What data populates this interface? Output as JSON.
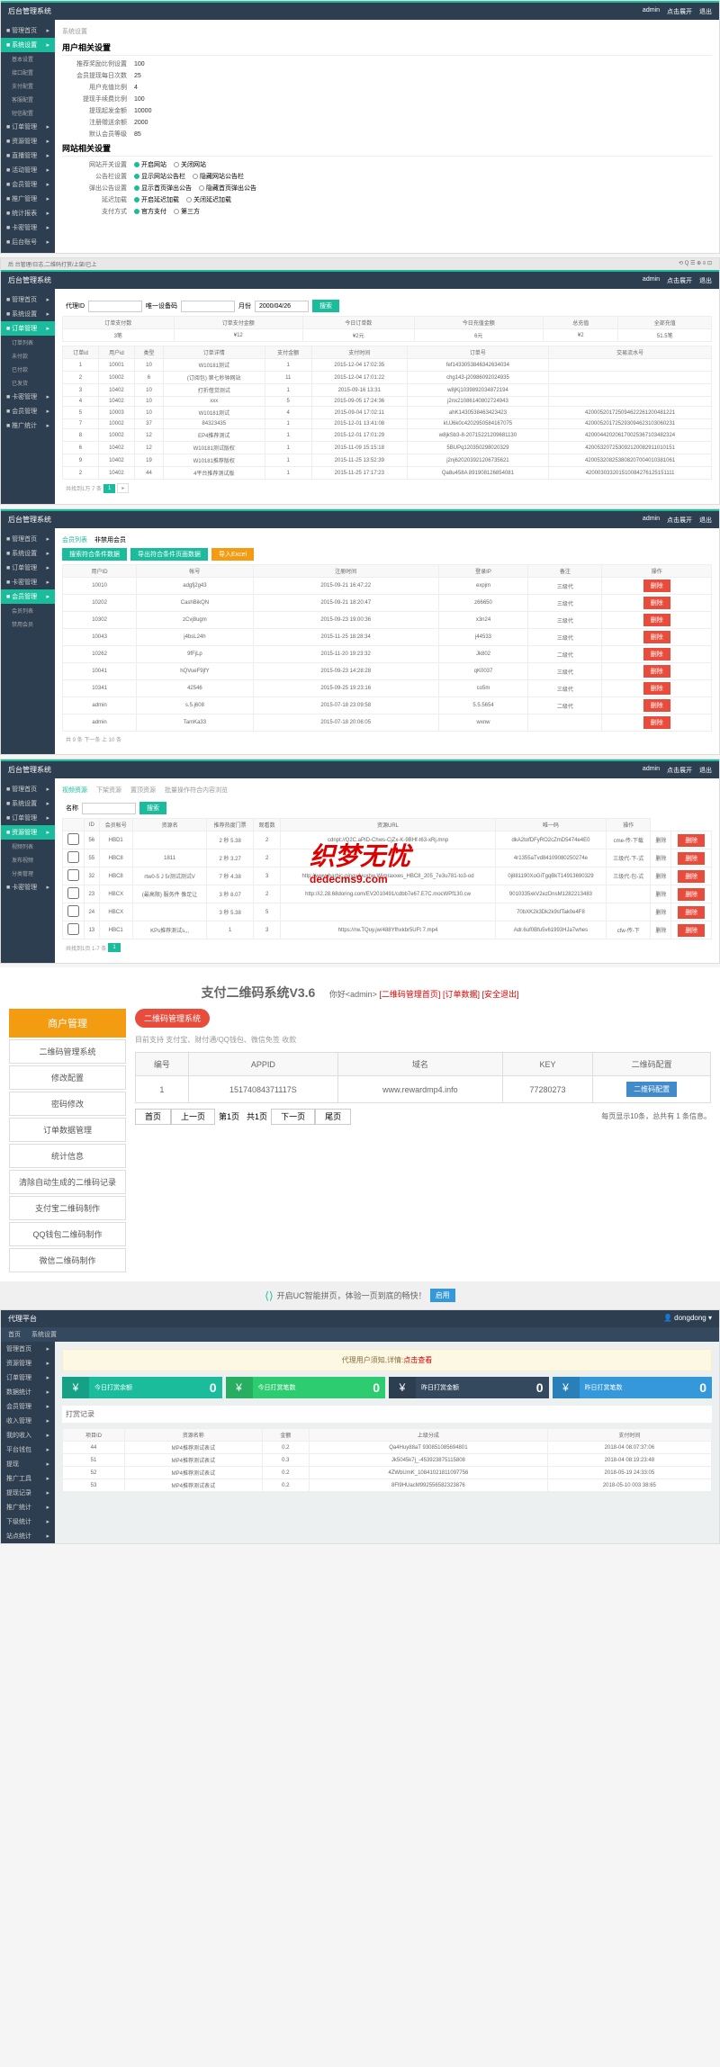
{
  "p1": {
    "title": "后台管理系统",
    "user": "admin",
    "menu_toggle": "点击展开",
    "logout": "退出",
    "sidebar": [
      "管理首页",
      "系统设置",
      "订单管理",
      "资源管理",
      "直播管理",
      "活动管理",
      "会员管理",
      "推广管理",
      "统计报表",
      "卡密管理",
      "后台账号"
    ],
    "sub_items": [
      "基本设置",
      "接口配置",
      "支付配置",
      "客服配置",
      "短信配置"
    ],
    "tab": "系统设置",
    "sec1": "用户相关设置",
    "rows1": [
      {
        "l": "推荐奖励比例设置",
        "v": "100"
      },
      {
        "l": "会员提现每日次数",
        "v": "25"
      },
      {
        "l": "用户充值比例",
        "v": "4"
      },
      {
        "l": "提现手续费比例",
        "v": "100"
      },
      {
        "l": "提现起发金额",
        "v": "10000"
      },
      {
        "l": "注册赠送余额",
        "v": "2000"
      },
      {
        "l": "默认会员等级",
        "v": "85"
      }
    ],
    "sec2": "网站相关设置",
    "rows2": [
      {
        "l": "网站开关设置",
        "opts": [
          "开启网站",
          "关闭网站"
        ]
      },
      {
        "l": "公告栏设置",
        "opts": [
          "显示网站公告栏",
          "隐藏网站公告栏"
        ]
      },
      {
        "l": "弹出公告设置",
        "opts": [
          "显示首页弹出公告",
          "隐藏首页弹出公告"
        ]
      },
      {
        "l": "延迟加载",
        "opts": [
          "开启延迟加载",
          "关闭延迟加载"
        ]
      },
      {
        "l": "支付方式",
        "opts": [
          "官方支付",
          "第三方"
        ]
      }
    ]
  },
  "p2": {
    "title": "后台管理系统",
    "user": "admin",
    "sidebar": [
      "管理首页",
      "系统设置",
      "订单管理",
      "卡密管理",
      "会员管理",
      "推广统计"
    ],
    "sub_items": [
      "订单列表",
      "未付款",
      "已付款",
      "已发货"
    ],
    "toolbar": {
      "l1": "代理ID",
      "l2": "唯一设备码",
      "l3": "月份",
      "date": "2000/04/26",
      "btn": "搜索"
    },
    "summary_headers": [
      "订单支付数",
      "订单支付金额",
      "今日订单数",
      "今日充值金额",
      "总充值",
      "全部充值"
    ],
    "summary_values": [
      "3笔",
      "¥12",
      "¥2元",
      "6元",
      "¥2",
      "51.5笔"
    ],
    "cols": [
      "订单id",
      "用户id",
      "类型",
      "订单详情",
      "支付金额",
      "支付时间",
      "订单号",
      "交易流水号"
    ],
    "rows": [
      [
        "1",
        "10001",
        "10",
        "W10181测试",
        "1",
        "2015-12-04 17:02:35",
        "fef1433053846342634034",
        ""
      ],
      [
        "2",
        "10002",
        "6",
        "(订阅包) 第七秒钟网站",
        "11",
        "2015-12-04 17:01:22",
        "chg143-j20986092024935",
        ""
      ],
      [
        "3",
        "10402",
        "10",
        "打折借贷测试",
        "1",
        "2015-09-16 13:31",
        "w8jKj1039892034872194",
        ""
      ],
      [
        "4",
        "10402",
        "10",
        "xxx",
        "5",
        "2015-09-05 17:24:36",
        "j2nx21086140802724943",
        ""
      ],
      [
        "5",
        "10003",
        "10",
        "W10181测试",
        "4",
        "2015-09-04 17:02:11",
        "ahK1430538463423423",
        "420005201725094622261200481221"
      ],
      [
        "7",
        "10002",
        "37",
        "84323435",
        "1",
        "2015-12-01 13:41:08",
        "kUJ6k0c4202950584167075",
        "420005201725293094623103060231"
      ],
      [
        "8",
        "10002",
        "12",
        "EP4推荐测试",
        "1",
        "2015-12-01 17:01:29",
        "w8jkSb3-8-20715221209681130",
        "420004420206170025367103482324"
      ],
      [
        "6",
        "10402",
        "12",
        "W10181测试版权",
        "1",
        "2015-11-09 15:15:18",
        "5BUPq120350298020329",
        "420053207253092120082911010151"
      ],
      [
        "9",
        "10402",
        "19",
        "W10181推荐版权",
        "1",
        "2015-11-25 13:52:39",
        "j2nj620203921206735621",
        "420053208253808207004010381061"
      ],
      [
        "2",
        "10402",
        "44",
        "4平台推荐测试版",
        "1",
        "2015-11-25 17:17:23",
        "Qa8u458A 891908126854081",
        "420003033201510084276125151111"
      ]
    ],
    "pager_info": "共找到1万 7 条"
  },
  "p3": {
    "title": "后台管理系统",
    "user": "admin",
    "sidebar": [
      "管理首页",
      "系统设置",
      "订单管理",
      "卡密管理",
      "会员管理"
    ],
    "sub_items": [
      "会员列表",
      "禁用会员"
    ],
    "tabs": [
      "会员列表",
      "非禁用会员"
    ],
    "btns": [
      "搜索符合条件数据",
      "导出符合条件页面数据",
      "导入Excel"
    ],
    "cols": [
      "用户ID",
      "帐号",
      "注册时间",
      "登录IP",
      "备注",
      "操作"
    ],
    "rows": [
      [
        "10010",
        "adgfj2g43",
        "2015-09-21 16:47:22",
        "expjm",
        "三级代",
        "删除"
      ],
      [
        "10202",
        "CashBikQN",
        "2015-09-21 18:20:47",
        "z66650",
        "三级代",
        "删除"
      ],
      [
        "10302",
        "zCvj8ugm",
        "2015-09-23 19:00:36",
        "x3n24",
        "三级代",
        "删除"
      ],
      [
        "10043",
        "j4bsL24h",
        "2015-11-25 18:28:34",
        "j44533",
        "三级代",
        "删除"
      ],
      [
        "10262",
        "9fFjLp",
        "2015-11-20 19:23:32",
        "Jk802",
        "二级代",
        "删除"
      ],
      [
        "10041",
        "hQVueF9jfY",
        "2015-09-23 14:28:28",
        "qK0037",
        "三级代",
        "删除"
      ],
      [
        "10341",
        "42546",
        "2015-09-25 19:23:16",
        "co5m",
        "三级代",
        "删除"
      ],
      [
        "admin",
        "s.5.j608",
        "2015-07-18 23:09:58",
        "5.5.5654",
        "二级代",
        "删除"
      ],
      [
        "admin",
        "TamKa33",
        "2015-07-18 20:06:05",
        "wxnw",
        "",
        "删除"
      ]
    ],
    "pager_info": "共 9 条 下一条 上 10 条"
  },
  "p4": {
    "title": "后台管理系统",
    "user": "admin",
    "sidebar": [
      "管理首页",
      "系统设置",
      "订单管理",
      "资源管理",
      "卡密管理"
    ],
    "sub_items": [
      "视频列表",
      "发布视频",
      "分类管理"
    ],
    "tabs": [
      "视频资源",
      "下架资源",
      "置顶资源",
      "批量操作符合内容浏览"
    ],
    "toolbar": {
      "l": "名称",
      "btn": "搜索"
    },
    "cols": [
      "",
      "ID",
      "会员帐号",
      "资源名",
      "推荐热度门票",
      "观看数",
      "资源URL",
      "唯一码",
      "操作"
    ],
    "rows": [
      [
        "",
        "56",
        "HBD1",
        "",
        "2 秒 5.38",
        "2",
        "cdnpt://Q2C.aPID-Chws-CjZx-K-9BHf-t63-xRj.mnp",
        "dkA2tofDFyRO2cZmD5474e4E0",
        "cme-传-下载",
        "删除"
      ],
      [
        "",
        "55",
        "HBC8",
        "1811",
        "2 秒 3.27",
        "2",
        "",
        "4r1355aTvd84109080250274e",
        "三级代-下-式",
        "删除"
      ],
      [
        "",
        "32",
        "HBC8",
        "rtw0-5 J 5r测试测试V",
        "7 秒 4.38",
        "3",
        "http://www.harbic-pjngwlyuxhw.Wimraxxes_HBC8_205_7e3u781-to3-od",
        "0j881190XoGiTgqBkT14913690329",
        "三级代-包-式",
        "删除"
      ],
      [
        "",
        "23",
        "HBCX",
        "(最高限) 服务件 像足让",
        "3 秒 8.07",
        "2",
        "http://i2.28.68doring.com/EV2010491/cdbb7e67.E7C.mocWPf130.cw",
        "9010335xkV2ezDnsM1282213483",
        "",
        "删除"
      ],
      [
        "",
        "24",
        "HBCX",
        "",
        "3 秒 5.38",
        "5",
        "",
        "70bXK2k3Dk2k9sfTak0e4F8",
        "",
        "删除"
      ],
      [
        "",
        "13",
        "HBC1",
        "KPs推荐测试s,,,",
        "1",
        "3",
        "https://rw.TQuy.jw/488Yfhxkbr5UFt 7.mp4",
        "Adr.6uf0Bfu5v61993HJa7whes",
        "cfw-传-下",
        "删除"
      ]
    ],
    "pager_info": "共找到1页 1-7 条"
  },
  "watermark": {
    "text": "织梦无忧",
    "url": "dedecms9.com"
  },
  "qr": {
    "title": "支付二维码系统V3.6",
    "greeting": "你好<admin>",
    "links": [
      "[二维码管理首页]",
      "[订单数据]",
      "[安全退出]"
    ],
    "nav_header": "商户管理",
    "nav": [
      "二维码管理系统",
      "修改配置",
      "密码修改",
      "订单数据管理",
      "统计信息",
      "清除自动生成的二维码记录",
      "支付宝二维码制作",
      "QQ钱包二维码制作",
      "微信二维码制作"
    ],
    "badge": "二维码管理系统",
    "desc": "目前支持 支付宝、财付通/QQ钱包、微信免签 收款",
    "cols": [
      "编号",
      "APPID",
      "域名",
      "KEY",
      "二维码配置"
    ],
    "row": [
      "1",
      "15174084371117S",
      "www.rewardmp4.info",
      "77280273"
    ],
    "config_btn": "二维码配置",
    "pager": [
      "首页",
      "上一页",
      "第1页",
      "共1页",
      "下一页",
      "尾页"
    ],
    "pager_info": "每页显示10条，总共有 1 条信息。"
  },
  "uc": {
    "text": "开启UC智能拼页，体验一页到底的畅快！",
    "btn": "启用"
  },
  "agent": {
    "title": "代理平台",
    "user": "dongdong",
    "nav": [
      "首页",
      "系统设置"
    ],
    "sidebar": [
      "管理首页",
      "资源管理",
      "订单管理",
      "数据统计",
      "会员管理",
      "收入管理",
      "我的收入",
      "平台钱包",
      "提现",
      "推广工具",
      "提现记录",
      "推广统计",
      "下级统计",
      "站点统计"
    ],
    "alert": "代理用户须知,详情:",
    "alert_link": "点击查看",
    "stats": [
      {
        "l": "今日打赏余额",
        "v": "0",
        "c": "teal"
      },
      {
        "l": "今日打赏笔数",
        "v": "0",
        "c": "green"
      },
      {
        "l": "昨日打赏金额",
        "v": "0",
        "c": "dark"
      },
      {
        "l": "昨日打赏笔数",
        "v": "0",
        "c": "blue"
      }
    ],
    "sub_title": "打赏记录",
    "cols": [
      "项目ID",
      "资源名称",
      "金额",
      "上级分成",
      "支付时间"
    ],
    "rows": [
      [
        "44",
        "MP4推荐测试表试",
        "0.2",
        "Qa4Huy88aT 930851085694801",
        "2018-04 08:07:37:06"
      ],
      [
        "51",
        "MP4推荐测试表试",
        "0.3",
        "Jk5045k7j_-453923875115808",
        "2018-04 08:19:23:48"
      ],
      [
        "52",
        "MP4推荐测试表试",
        "0.2",
        "4ZWbUmK_10841021811097756",
        "2018-05-19 24:33:05"
      ],
      [
        "53",
        "MP4推荐测试表试",
        "0.2",
        "8Fl9HUacM992556582323876",
        "2018-05-10 003 38:65"
      ]
    ]
  }
}
